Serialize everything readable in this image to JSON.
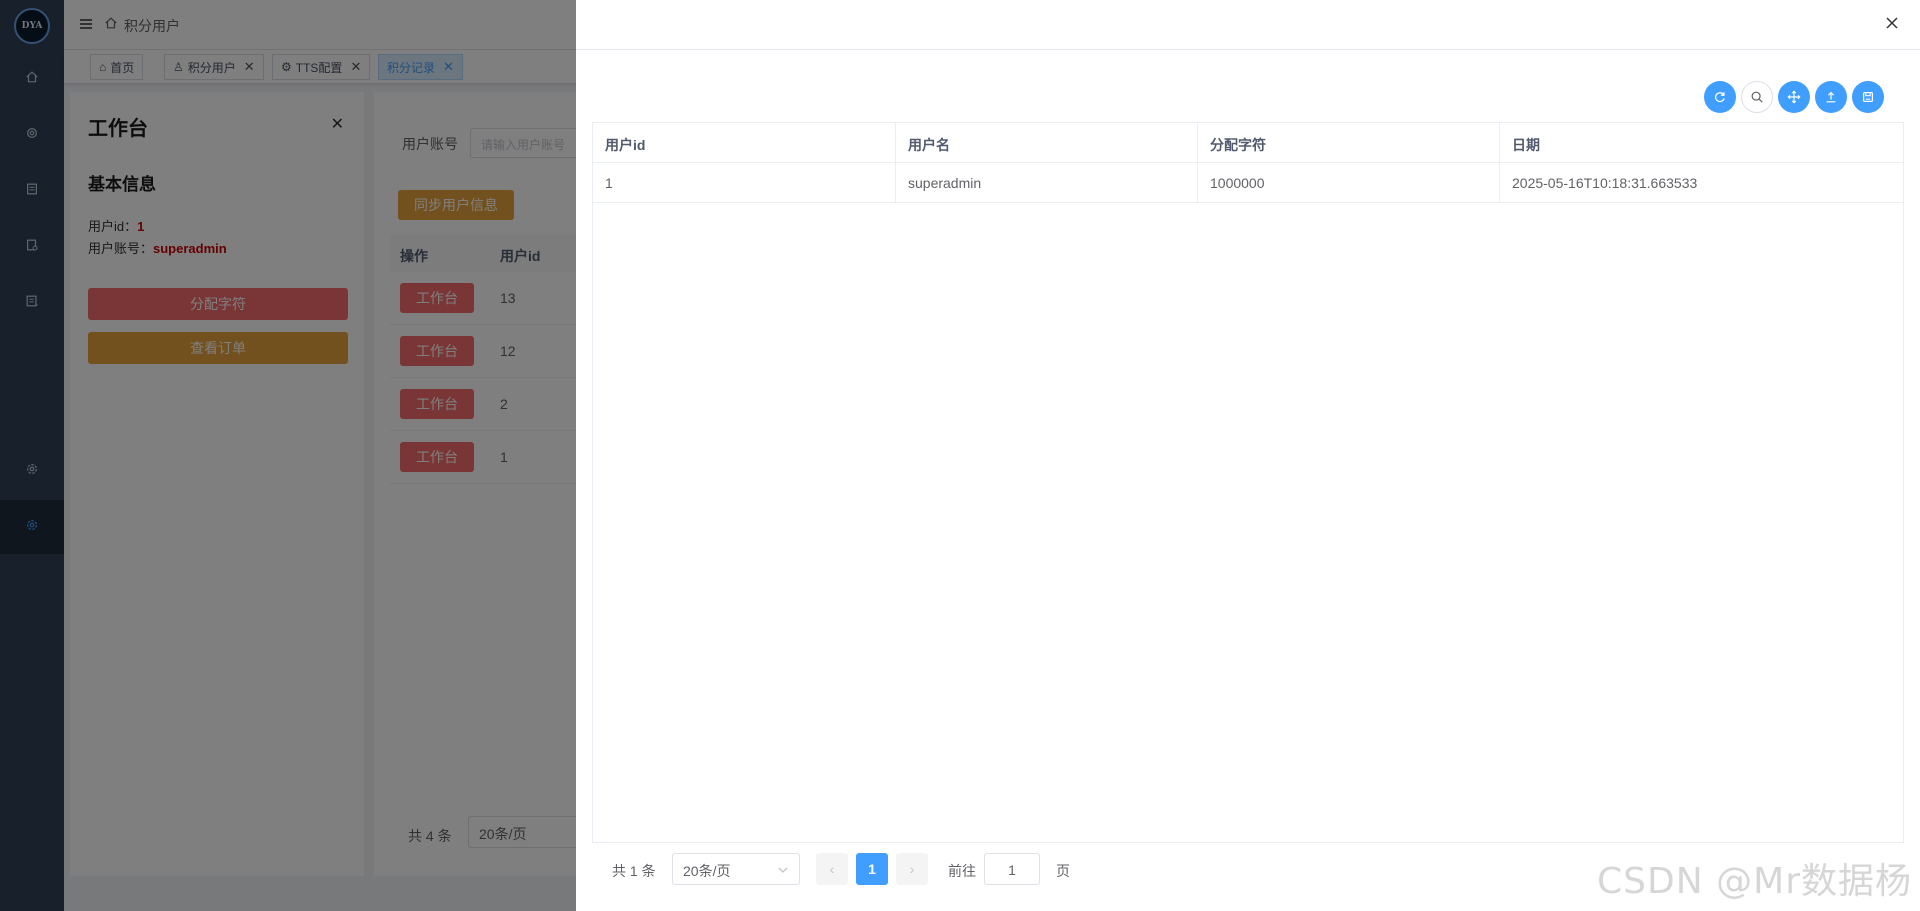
{
  "logo": {
    "text": "DYA"
  },
  "sidebar": {
    "icons": [
      "home-icon",
      "gear-icon",
      "document-icon",
      "file-settings-icon",
      "list-icon",
      "settings-icon",
      "settings-active-icon"
    ]
  },
  "header": {
    "breadcrumb": "积分用户"
  },
  "tabs": [
    {
      "label": "首页",
      "icon": "home-icon",
      "closable": false,
      "active": false
    },
    {
      "label": "积分用户",
      "icon": "user-icon",
      "closable": true,
      "active": false
    },
    {
      "label": "TTS配置",
      "icon": "gear-icon",
      "closable": true,
      "active": false
    },
    {
      "label": "积分记录",
      "icon": "",
      "closable": true,
      "active": true
    }
  ],
  "workpanel": {
    "title": "工作台",
    "section": "基本信息",
    "user_id_label": "用户id：",
    "user_id_value": "1",
    "account_label": "用户账号：",
    "account_value": "superadmin",
    "btn_assign": "分配字符",
    "btn_orders": "查看订单"
  },
  "content": {
    "search_label": "用户账号",
    "search_placeholder": "请输入用户账号",
    "sync_button": "同步用户信息",
    "columns": [
      "操作",
      "用户id"
    ],
    "rows": [
      {
        "op": "工作台",
        "uid": "13"
      },
      {
        "op": "工作台",
        "uid": "12"
      },
      {
        "op": "工作台",
        "uid": "2"
      },
      {
        "op": "工作台",
        "uid": "1"
      }
    ],
    "total": "共 4 条",
    "page_size": "20条/页"
  },
  "drawer": {
    "toolbar": [
      "refresh-icon",
      "search-icon",
      "move-icon",
      "upload-icon",
      "save-icon"
    ],
    "columns": [
      "用户id",
      "用户名",
      "分配字符",
      "日期"
    ],
    "rows": [
      [
        "1",
        "superadmin",
        "1000000",
        "2025-05-16T10:18:31.663533"
      ]
    ],
    "pagination": {
      "total": "共 1 条",
      "page_size": "20条/页",
      "prev": "‹",
      "current": "1",
      "next": "›",
      "goto_label": "前往",
      "goto_value": "1",
      "goto_unit": "页"
    }
  },
  "watermark": "CSDN @Mr数据杨",
  "colors": {
    "sidebar": "#304156",
    "primary": "#409eff",
    "danger": "#f56c6c",
    "warning": "#e6a23c"
  }
}
